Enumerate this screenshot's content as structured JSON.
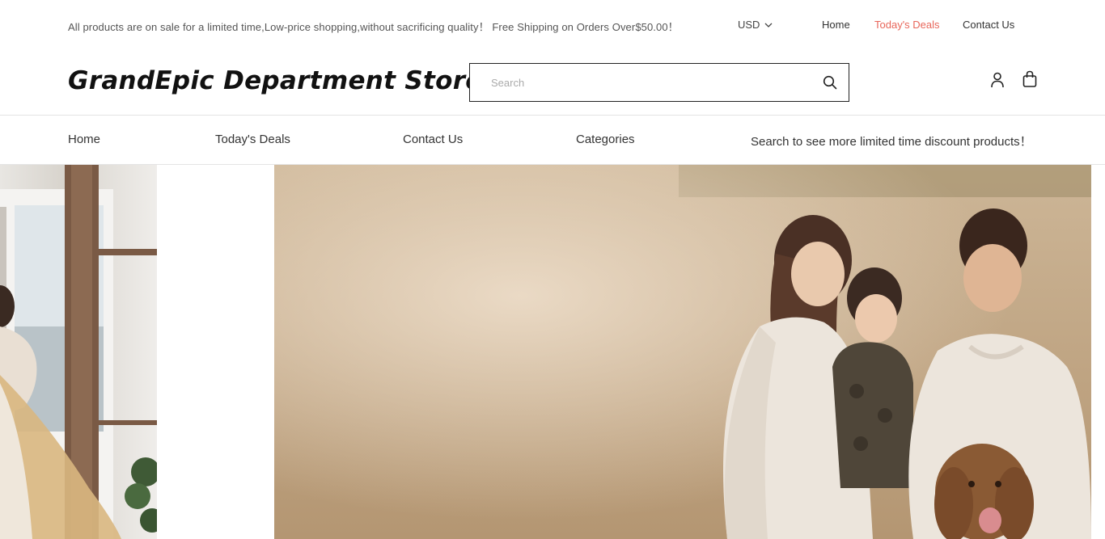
{
  "topbar": {
    "announcement": "All products are on sale for a limited time,Low-price shopping,without sacrificing quality！ Free Shipping on Orders Over$50.00！",
    "currency": "USD",
    "links": {
      "home": "Home",
      "deals": "Today's Deals",
      "contact": "Contact Us"
    }
  },
  "header": {
    "logo": "GrandEpic Department Store",
    "search": {
      "placeholder": "Search",
      "value": ""
    },
    "icons": [
      "search-icon",
      "user-icon",
      "shopping-bag-icon"
    ]
  },
  "nav": {
    "home": "Home",
    "deals": "Today's Deals",
    "contact": "Contact Us",
    "categories": "Categories",
    "promo": "Search to see more limited time discount products！"
  },
  "colors": {
    "accent": "#e8665a",
    "text": "#333333",
    "border": "#222222"
  }
}
